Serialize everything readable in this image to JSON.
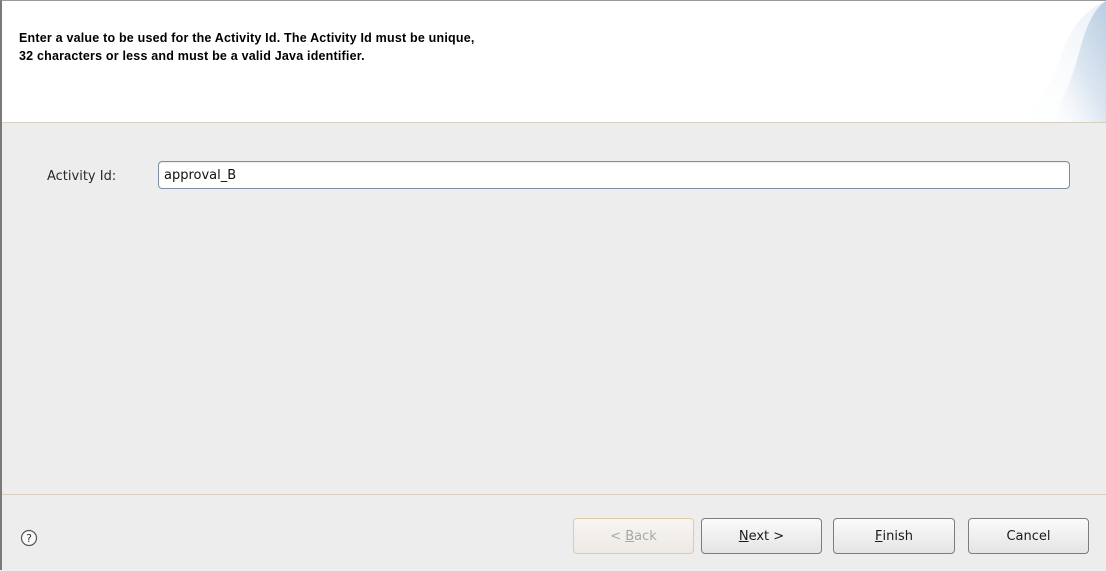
{
  "header": {
    "message_line1": "Enter a value to be used for the Activity Id. The Activity Id must be unique,",
    "message_line2": "32 characters or less and must be a valid Java identifier."
  },
  "form": {
    "activity_id_label": "Activity Id:",
    "activity_id_value": "approval_B"
  },
  "buttons": {
    "back": {
      "prefix": "< ",
      "mnemonic": "B",
      "rest": "ack",
      "enabled": false
    },
    "next": {
      "mnemonic": "N",
      "rest": "ext >",
      "enabled": true
    },
    "finish": {
      "mnemonic": "F",
      "rest": "inish",
      "enabled": true
    },
    "cancel": {
      "label": "Cancel",
      "enabled": true
    }
  },
  "icons": {
    "help": "help-icon"
  },
  "colors": {
    "header_bg": "#ffffff",
    "body_bg": "#ededed",
    "input_border": "#7b8ea3",
    "separator": "#d8cfc0",
    "banner_accent": "#c9d9ea"
  }
}
